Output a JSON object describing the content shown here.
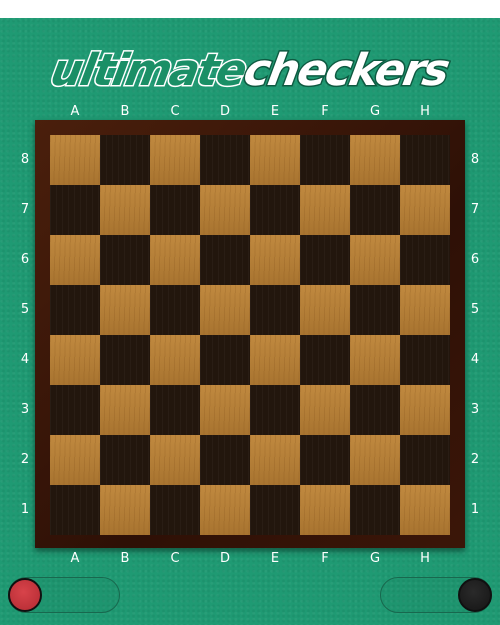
{
  "logo": {
    "part1": "ultimate",
    "part2": "checkers"
  },
  "columns": [
    "A",
    "B",
    "C",
    "D",
    "E",
    "F",
    "G",
    "H"
  ],
  "rows": [
    "8",
    "7",
    "6",
    "5",
    "4",
    "3",
    "2",
    "1"
  ],
  "board": {
    "size": 8,
    "top_left_square": "light"
  },
  "players": [
    {
      "id": "red",
      "color": "#c73038"
    },
    {
      "id": "black",
      "color": "#1a1a1a"
    }
  ],
  "colors": {
    "felt": "#1f9a73",
    "frame": "#3b1608",
    "light_square": "#b57d38",
    "dark_square": "#22160d"
  }
}
